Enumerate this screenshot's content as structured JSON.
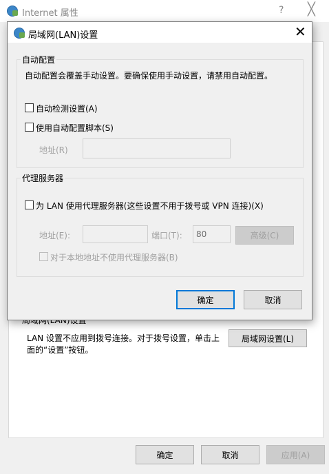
{
  "background": {
    "title": "Internet 属性",
    "help": "?",
    "close": "╳",
    "lan_group_label": "局域网(LAN)设置",
    "lan_text": "LAN 设置不应用到拨号连接。对于拨号设置，单击上面的“设置”按钮。",
    "lan_button": "局域网设置(L)",
    "ok": "确定",
    "cancel": "取消",
    "apply": "应用(A)"
  },
  "dialog": {
    "title": "局域网(LAN)设置",
    "close": "✕",
    "auto_config": {
      "label": "自动配置",
      "description": "自动配置会覆盖手动设置。要确保使用手动设置，请禁用自动配置。",
      "auto_detect": "自动检测设置(A)",
      "use_script": "使用自动配置脚本(S)",
      "address_label": "地址(R)",
      "address_value": ""
    },
    "proxy": {
      "label": "代理服务器",
      "use_proxy": "为 LAN 使用代理服务器(这些设置不用于拨号或 VPN 连接)(X)",
      "address_label": "地址(E):",
      "address_value": "",
      "port_label": "端口(T):",
      "port_value": "80",
      "advanced": "高级(C)",
      "bypass_local": "对于本地地址不使用代理服务器(B)"
    },
    "ok": "确定",
    "cancel": "取消"
  }
}
